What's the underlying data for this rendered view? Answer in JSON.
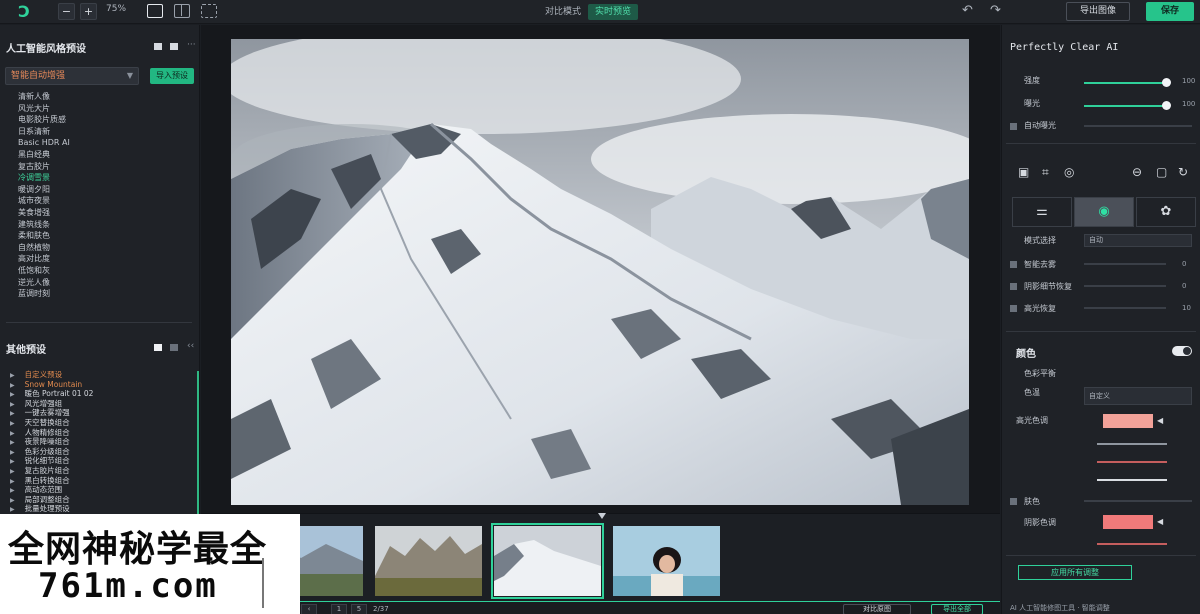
{
  "topbar": {
    "logo": "ꓛ",
    "zoom_minus": "−",
    "zoom_plus": "+",
    "zoom_value": "75%",
    "modes": [
      {
        "label": "对比模式",
        "active": false
      },
      {
        "label": "实时预览",
        "active": true
      }
    ],
    "undo": "↶",
    "redo": "↷",
    "export_label": "导出图像",
    "save_label": "保存"
  },
  "left": {
    "title": "人工智能风格预设",
    "select_value": "智能自动增强",
    "load_label": "导入预设",
    "styles": [
      {
        "label": "清新人像",
        "active": false
      },
      {
        "label": "风光大片",
        "active": false
      },
      {
        "label": "电影胶片质感",
        "active": false
      },
      {
        "label": "日系清新",
        "active": false
      },
      {
        "label": "Basic HDR AI",
        "active": false
      },
      {
        "label": "黑白经典",
        "active": false
      },
      {
        "label": "复古胶片",
        "active": false
      },
      {
        "label": "冷调雪景",
        "active": true
      },
      {
        "label": "暖调夕阳",
        "active": false
      },
      {
        "label": "城市夜景",
        "active": false
      },
      {
        "label": "美食增强",
        "active": false
      },
      {
        "label": "建筑线条",
        "active": false
      },
      {
        "label": "柔和肤色",
        "active": false
      },
      {
        "label": "自然植物",
        "active": false
      },
      {
        "label": "高对比度",
        "active": false
      },
      {
        "label": "低饱和灰",
        "active": false
      },
      {
        "label": "逆光人像",
        "active": false
      },
      {
        "label": "蓝调时刻",
        "active": false
      }
    ],
    "history_title": "其他预设",
    "tree": [
      {
        "label": "自定义预设",
        "hl": true
      },
      {
        "label": "Snow Mountain",
        "hl": true
      },
      {
        "label": "暖色 Portrait 01 02",
        "hl": false
      },
      {
        "label": "风光增强组",
        "hl": false
      },
      {
        "label": "一键去雾增强",
        "hl": false
      },
      {
        "label": "天空替换组合",
        "hl": false
      },
      {
        "label": "人物精修组合",
        "hl": false
      },
      {
        "label": "夜景降噪组合",
        "hl": false
      },
      {
        "label": "色彩分级组合",
        "hl": false
      },
      {
        "label": "锐化细节组合",
        "hl": false
      },
      {
        "label": "复古胶片组合",
        "hl": false
      },
      {
        "label": "黑白转换组合",
        "hl": false
      },
      {
        "label": "高动态范围",
        "hl": false
      },
      {
        "label": "局部调整组合",
        "hl": false
      },
      {
        "label": "批量处理预设",
        "hl": false
      }
    ]
  },
  "bottombar": {
    "page_prev": "‹",
    "page_num": "1",
    "page_total": "5",
    "count": "2/37",
    "compare_label": "对比原图",
    "export_label": "导出全部"
  },
  "watermark": {
    "line1": "全网神秘学最全",
    "line2": "761m.com"
  },
  "right": {
    "title": "Perfectly Clear AI",
    "sliders": [
      {
        "label": "强度",
        "value": "100",
        "level": 1.0
      },
      {
        "label": "曝光",
        "value": "100",
        "level": 1.0
      }
    ],
    "auto_label": "自动曝光",
    "section_sliders": [
      {
        "label": "智能去雾",
        "value": "0"
      },
      {
        "label": "阴影细节恢复",
        "value": "0"
      },
      {
        "label": "高光恢复",
        "value": "10"
      }
    ],
    "mode_label": "模式选择",
    "mode_value": "自动",
    "color_title": "颜色",
    "color_sub1": "色彩平衡",
    "color_sub2": "色温",
    "color_dd": "自定义",
    "color_label": "高光色调",
    "skin_label": "肤色",
    "tone_label": "阴影色调",
    "apply_label": "应用所有调整",
    "footer": "AI 人工智能修图工具 · 智能调整"
  }
}
